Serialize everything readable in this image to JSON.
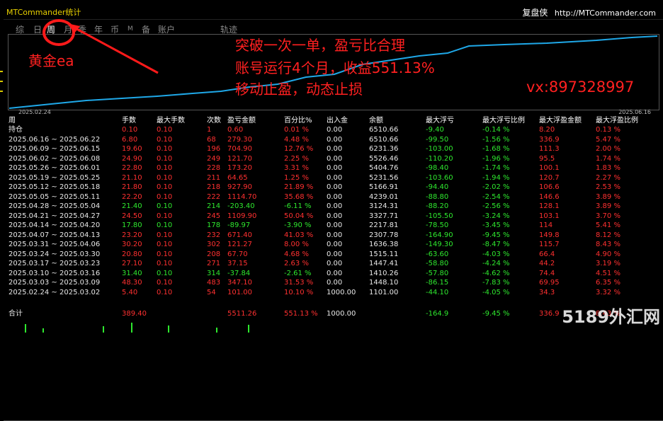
{
  "window": {
    "title": "MTCommander统计",
    "right_label": "复盘侠",
    "url": "http://MTCommander.com"
  },
  "tabs": [
    {
      "label": "综"
    },
    {
      "label": "日"
    },
    {
      "label": "周"
    },
    {
      "label": "月"
    },
    {
      "label": "季"
    },
    {
      "label": "年"
    },
    {
      "label": "币"
    },
    {
      "label": "M"
    },
    {
      "label": "备"
    },
    {
      "label": "账户"
    },
    {
      "label": "轨迹"
    }
  ],
  "active_tab": "周",
  "chart": {
    "start_date": "2025.02.24",
    "end_date": "2025.06.16",
    "line_color": "#1fa8e8"
  },
  "annotations": {
    "gold": "黄金ea",
    "line1": "突破一次一单，盈亏比合理",
    "line2": "账号运行4个月，收益551.13%",
    "line3": "移动止盈，动态止损",
    "vx": "vx:897328997",
    "color": "#ff2020"
  },
  "table": {
    "headers": [
      "周",
      "手数",
      "最大手数",
      "次数",
      "盈亏金额",
      "百分比%",
      "出入金",
      "余额",
      "最大浮亏",
      "最大浮亏比例",
      "最大浮盈金额",
      "最大浮盈比例"
    ],
    "rows": [
      [
        "持仓",
        "0.10",
        "0.10",
        "1",
        "0.60",
        "0.01 %",
        "0.00",
        "6510.66",
        "-9.40",
        "-0.14 %",
        "8.20",
        "0.13 %"
      ],
      [
        "2025.06.16 ~ 2025.06.22",
        "6.80",
        "0.10",
        "68",
        "279.30",
        "4.48 %",
        "0.00",
        "6510.66",
        "-99.50",
        "-1.56 %",
        "336.9",
        "5.47 %"
      ],
      [
        "2025.06.09 ~ 2025.06.15",
        "19.60",
        "0.10",
        "196",
        "704.90",
        "12.76 %",
        "0.00",
        "6231.36",
        "-103.00",
        "-1.68 %",
        "111.3",
        "2.00 %"
      ],
      [
        "2025.06.02 ~ 2025.06.08",
        "24.90",
        "0.10",
        "249",
        "121.70",
        "2.25 %",
        "0.00",
        "5526.46",
        "-110.20",
        "-1.96 %",
        "95.5",
        "1.74 %"
      ],
      [
        "2025.05.26 ~ 2025.06.01",
        "22.80",
        "0.10",
        "228",
        "173.20",
        "3.31 %",
        "0.00",
        "5404.76",
        "-98.40",
        "-1.74 %",
        "100.1",
        "1.83 %"
      ],
      [
        "2025.05.19 ~ 2025.05.25",
        "21.10",
        "0.10",
        "211",
        "64.65",
        "1.25 %",
        "0.00",
        "5231.56",
        "-103.60",
        "-1.94 %",
        "120.7",
        "2.27 %"
      ],
      [
        "2025.05.12 ~ 2025.05.18",
        "21.80",
        "0.10",
        "218",
        "927.90",
        "21.89 %",
        "0.00",
        "5166.91",
        "-94.40",
        "-2.02 %",
        "106.6",
        "2.53 %"
      ],
      [
        "2025.05.05 ~ 2025.05.11",
        "22.20",
        "0.10",
        "222",
        "1114.70",
        "35.68 %",
        "0.00",
        "4239.01",
        "-88.80",
        "-2.54 %",
        "146.6",
        "3.89 %"
      ],
      [
        "2025.04.28 ~ 2025.05.04",
        "21.40",
        "0.10",
        "214",
        "-203.40",
        "-6.11 %",
        "0.00",
        "3124.31",
        "-88.20",
        "-2.56 %",
        "128.1",
        "3.89 %"
      ],
      [
        "2025.04.21 ~ 2025.04.27",
        "24.50",
        "0.10",
        "245",
        "1109.90",
        "50.04 %",
        "0.00",
        "3327.71",
        "-105.50",
        "-3.24 %",
        "103.1",
        "3.70 %"
      ],
      [
        "2025.04.14 ~ 2025.04.20",
        "17.80",
        "0.10",
        "178",
        "-89.97",
        "-3.90 %",
        "0.00",
        "2217.81",
        "-78.50",
        "-3.45 %",
        "114",
        "5.41 %"
      ],
      [
        "2025.04.07 ~ 2025.04.13",
        "23.20",
        "0.10",
        "232",
        "671.40",
        "41.03 %",
        "0.00",
        "2307.78",
        "-164.90",
        "-9.45 %",
        "149.8",
        "8.12 %"
      ],
      [
        "2025.03.31 ~ 2025.04.06",
        "30.20",
        "0.10",
        "302",
        "121.27",
        "8.00 %",
        "0.00",
        "1636.38",
        "-149.30",
        "-8.47 %",
        "115.7",
        "8.43 %"
      ],
      [
        "2025.03.24 ~ 2025.03.30",
        "20.80",
        "0.10",
        "208",
        "67.70",
        "4.68 %",
        "0.00",
        "1515.11",
        "-63.60",
        "-4.03 %",
        "66.4",
        "4.90 %"
      ],
      [
        "2025.03.17 ~ 2025.03.23",
        "27.10",
        "0.10",
        "271",
        "37.15",
        "2.63 %",
        "0.00",
        "1447.41",
        "-58.80",
        "-4.24 %",
        "44.2",
        "3.19 %"
      ],
      [
        "2025.03.10 ~ 2025.03.16",
        "31.40",
        "0.10",
        "314",
        "-37.84",
        "-2.61 %",
        "0.00",
        "1410.26",
        "-57.80",
        "-4.62 %",
        "74.4",
        "4.51 %"
      ],
      [
        "2025.03.03 ~ 2025.03.09",
        "48.30",
        "0.10",
        "483",
        "347.10",
        "31.53 %",
        "0.00",
        "1448.10",
        "-86.15",
        "-7.83 %",
        "69.95",
        "6.35 %"
      ],
      [
        "2025.02.24 ~ 2025.03.02",
        "5.40",
        "0.10",
        "54",
        "101.00",
        "10.10 %",
        "1000.00",
        "1101.00",
        "-44.10",
        "-4.05 %",
        "34.3",
        "3.32 %"
      ]
    ],
    "total": [
      "合计",
      "389.40",
      "",
      "",
      "5511.26",
      "551.13 %",
      "1000.00",
      "",
      "-164.9",
      "-9.45 %",
      "336.9",
      "8.43 %"
    ]
  },
  "watermark": "5189外汇网"
}
